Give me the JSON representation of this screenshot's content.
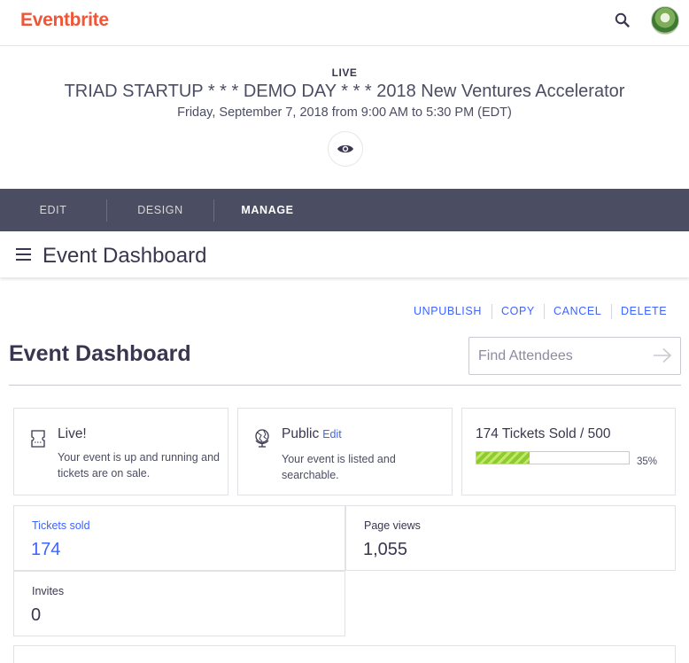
{
  "brand": {
    "name": "Eventbrite",
    "color": "#f05537"
  },
  "header": {
    "search_icon": "search-icon",
    "avatar": "user-avatar"
  },
  "event": {
    "status": "LIVE",
    "title": "TRIAD STARTUP * * * DEMO DAY * * * 2018 New Ventures Accelerator",
    "date": "Friday, September 7, 2018 from 9:00 AM to 5:30 PM (EDT)",
    "preview_icon": "eye-icon"
  },
  "tabs": [
    {
      "label": "EDIT",
      "active": false
    },
    {
      "label": "DESIGN",
      "active": false
    },
    {
      "label": "MANAGE",
      "active": true
    }
  ],
  "subheader": {
    "title": "Event Dashboard",
    "menu_icon": "hamburger-icon"
  },
  "actions": [
    "UNPUBLISH",
    "COPY",
    "CANCEL",
    "DELETE"
  ],
  "dashboard": {
    "heading": "Event Dashboard",
    "find_placeholder": "Find Attendees",
    "find_value": ""
  },
  "cards": {
    "live": {
      "title": "Live!",
      "text": "Your event is up and running and tickets are on sale.",
      "icon": "ticket-icon"
    },
    "public": {
      "title": "Public",
      "link": "Edit",
      "text": "Your event is listed and searchable.",
      "icon": "globe-icon"
    },
    "tickets": {
      "title": "174 Tickets Sold / 500",
      "progress": 0.35,
      "progress_label": "35%"
    }
  },
  "stats": [
    {
      "label": "Tickets sold",
      "value": "174"
    },
    {
      "label": "Page views",
      "value": "1,055"
    },
    {
      "label": "Invites",
      "value": "0"
    }
  ],
  "colors": {
    "accent": "#3d64ff",
    "nav": "#4b4d63",
    "progress": "#8ccc2f"
  }
}
